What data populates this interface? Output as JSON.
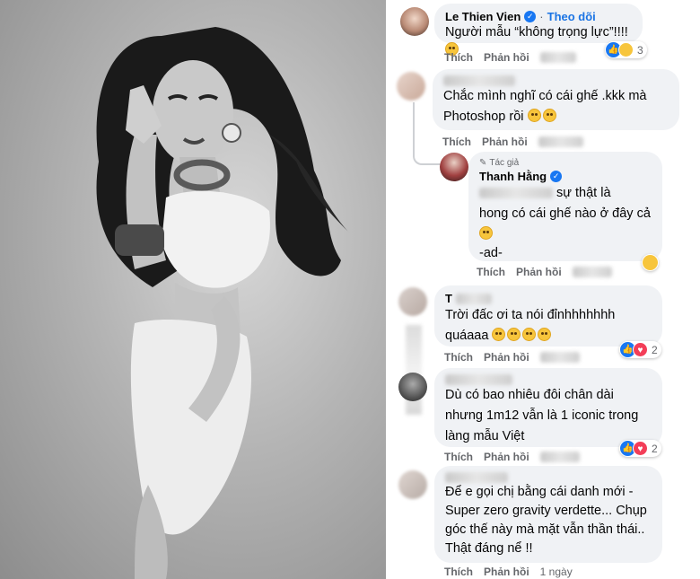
{
  "comments": [
    {
      "name": "Le Thien Vien",
      "follow": "Theo dõi",
      "text": "Người mẫu “không trọng lực”!!!!",
      "like": "Thích",
      "reply": "Phản hồi",
      "reactions": "3"
    },
    {
      "name": "",
      "text_lines": [
        "Chắc mình nghĩ có cái ghế .kkk mà",
        "Photoshop rồi"
      ],
      "like": "Thích",
      "reply": "Phản hồi"
    },
    {
      "author_tag": "Tác giả",
      "name": "Thanh Hằng",
      "text_lines": [
        "sự thật là",
        "hong có cái ghế nào ở đây cả",
        "-ad-"
      ],
      "like": "Thích",
      "reply": "Phản hồi"
    },
    {
      "name": "T",
      "text_lines": [
        "Trời đấc ơi ta nói đỉnhhhhhhh",
        "quáaaa"
      ],
      "like": "Thích",
      "reply": "Phản hồi",
      "reactions": "2"
    },
    {
      "name": "",
      "text_lines": [
        "Dù có bao nhiêu đôi chân dài",
        "nhưng 1m12 vẫn là 1 iconic trong",
        "làng mẫu Việt"
      ],
      "like": "Thích",
      "reply": "Phản hồi",
      "reactions": "2"
    },
    {
      "name": "",
      "text_lines": [
        "Để e gọi chị bằng cái danh mới -",
        "Super zero gravity verdette... Chụp",
        "góc thế này mà mặt vẫn thần thái..",
        "Thật đáng nể !!"
      ],
      "like": "Thích",
      "reply": "Phản hồi",
      "time": "1 ngày"
    }
  ],
  "icons": {
    "verified": "verified-badge-icon",
    "like": "like-reaction-icon",
    "love": "love-reaction-icon",
    "haha": "haha-reaction-icon",
    "author": "pen-icon"
  },
  "colors": {
    "bubble": "#f0f2f5",
    "link": "#1b74e4",
    "meta": "#65676b",
    "like": "#1877f2",
    "love": "#f33e58"
  }
}
